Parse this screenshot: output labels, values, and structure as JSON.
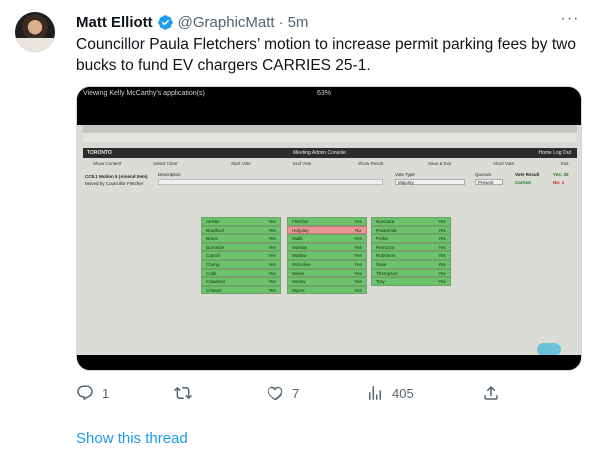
{
  "tweet": {
    "author_name": "Matt Elliott",
    "handle": "@GraphicMatt",
    "separator": "·",
    "time": "5m",
    "more_label": "···",
    "text": "Councillor Paula Fletchers’ motion to increase permit parking fees by two bucks to fund EV chargers CARRIES 25-1."
  },
  "media": {
    "top_label": "Viewing Kelly McCarthy's application(s)",
    "zoom": "63%",
    "app_logo": "TORONTO",
    "app_title": "Meeting Admin Console",
    "app_right": "Home   Log Out",
    "tools": [
      "Show Content",
      "Select Clear",
      "Start Vote",
      "End Vote",
      "Show Result",
      "Save & Exit",
      "Abort Vote",
      "Exit"
    ],
    "motion_label": "CC8.1 Motion 5 (Amend Item)",
    "moved_by": "Moved by Councillor Fletcher",
    "description_label": "Description",
    "vote_type_label": "Vote Type",
    "vote_type_value": "Majority",
    "quorum_label": "Quorum",
    "quorum_value": "Present",
    "vote_result_label": "Vote Result",
    "result_value": "Carried",
    "yes_count": "Yes: 25",
    "no_count": "No: 1",
    "columns": [
      [
        {
          "name": "Ainslie",
          "vote": "Yes"
        },
        {
          "name": "Bradford",
          "vote": "Yes"
        },
        {
          "name": "Bravo",
          "vote": "Yes"
        },
        {
          "name": "Burnside",
          "vote": "Yes"
        },
        {
          "name": "Carroll",
          "vote": "Yes"
        },
        {
          "name": "Cheng",
          "vote": "Yes"
        },
        {
          "name": "Colle",
          "vote": "Yes"
        },
        {
          "name": "Crawford",
          "vote": "Yes"
        },
        {
          "name": "Crisanti",
          "vote": "Yes"
        }
      ],
      [
        {
          "name": "Fletcher",
          "vote": "Yes"
        },
        {
          "name": "Holyday",
          "vote": "No"
        },
        {
          "name": "Malik",
          "vote": "Yes"
        },
        {
          "name": "Mantas",
          "vote": "Yes"
        },
        {
          "name": "Matlow",
          "vote": "Yes"
        },
        {
          "name": "McKelvie",
          "vote": "Yes"
        },
        {
          "name": "Moise",
          "vote": "Yes"
        },
        {
          "name": "Morley",
          "vote": "Yes"
        },
        {
          "name": "Myers",
          "vote": "Yes"
        }
      ],
      [
        {
          "name": "Nunziata",
          "vote": "Yes"
        },
        {
          "name": "Pasternak",
          "vote": "Yes"
        },
        {
          "name": "Perks",
          "vote": "Yes"
        },
        {
          "name": "Perruzza",
          "vote": "Yes"
        },
        {
          "name": "Robinson",
          "vote": "Yes"
        },
        {
          "name": "Saxe",
          "vote": "Yes"
        },
        {
          "name": "Thompson",
          "vote": "Yes"
        },
        {
          "name": "Tory",
          "vote": "Yes"
        }
      ]
    ]
  },
  "actions": {
    "replies": "1",
    "retweets": "",
    "likes": "7",
    "views": "405"
  },
  "show_thread": "Show this thread",
  "colors": {
    "verified": "#1d9bf0",
    "link": "#1d9bf0",
    "muted": "#536471",
    "vote_yes": "#6cc36a",
    "vote_no": "#e89595"
  },
  "icons": [
    "verified-badge-icon",
    "more-icon",
    "reply-icon",
    "retweet-icon",
    "like-icon",
    "views-icon",
    "share-icon"
  ]
}
